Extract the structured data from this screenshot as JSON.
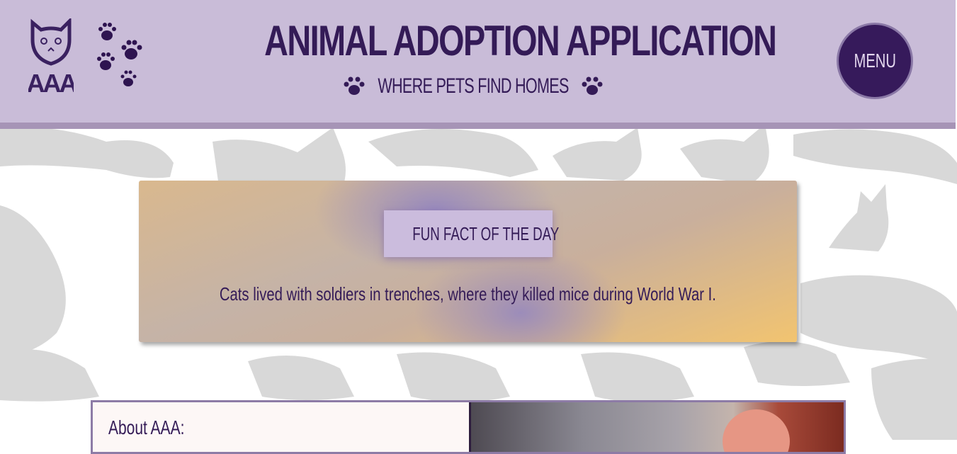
{
  "header": {
    "logo_text": "AAA",
    "title": "ANIMAL ADOPTION APPLICATION",
    "subtitle": "WHERE PETS FIND HOMES",
    "menu_label": "MENU"
  },
  "fun_fact": {
    "label": "FUN FACT OF THE DAY",
    "text": "Cats lived with soldiers in trenches, where they killed mice during World War I."
  },
  "about": {
    "title": "About AAA:"
  },
  "colors": {
    "header_bg": "#c9bcd8",
    "brand_dark": "#341b57",
    "card_orange": "#f2c470",
    "card_purple": "#9688be"
  },
  "icons": [
    "cat-logo-icon",
    "paw-print-icon",
    "menu-circle-button"
  ]
}
